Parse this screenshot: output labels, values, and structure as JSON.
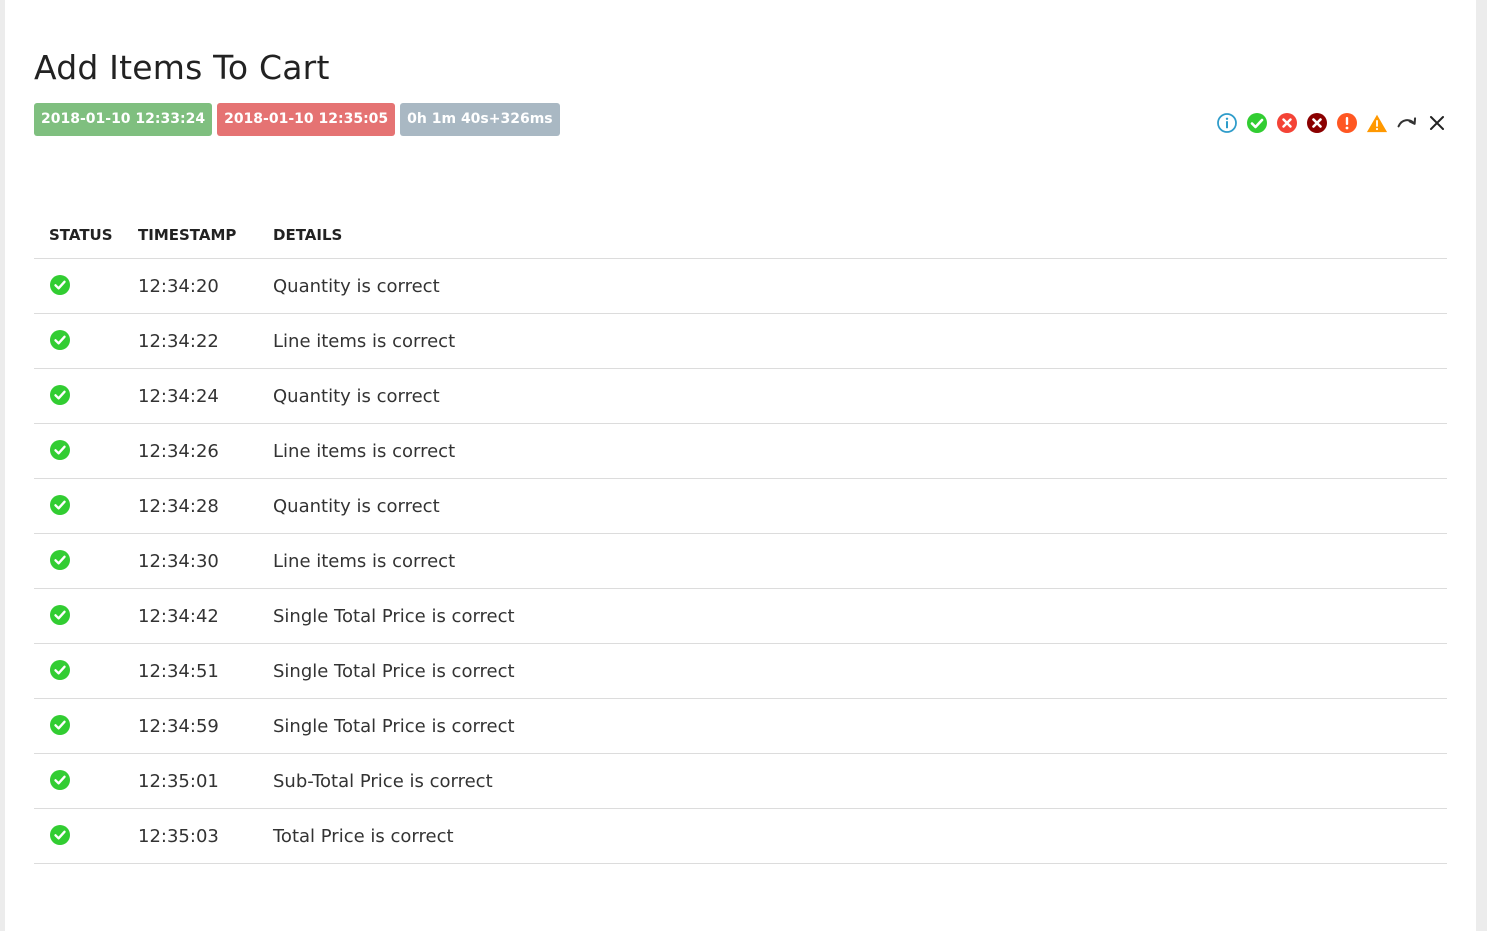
{
  "test": {
    "title": "Add Items To Cart",
    "start_time": "2018-01-10 12:33:24",
    "end_time": "2018-01-10 12:35:05",
    "duration": "0h 1m 40s+326ms"
  },
  "colors": {
    "pass": "#32cd32",
    "fail": "#f44336",
    "fatal": "#8b0000",
    "error": "#ff5722",
    "warning": "#ff9800",
    "info": "#2e9cca"
  },
  "filters": [
    {
      "name": "filter-info-icon",
      "icon": "info-circle-icon"
    },
    {
      "name": "filter-pass-icon",
      "icon": "check-circle-icon"
    },
    {
      "name": "filter-fail-icon",
      "icon": "x-circle-icon"
    },
    {
      "name": "filter-fatal-icon",
      "icon": "x-circle-dark-icon"
    },
    {
      "name": "filter-error-icon",
      "icon": "exclamation-circle-icon"
    },
    {
      "name": "filter-warning-icon",
      "icon": "warning-triangle-icon"
    },
    {
      "name": "filter-skip-icon",
      "icon": "redo-arrow-icon"
    },
    {
      "name": "clear-filter-icon",
      "icon": "close-icon"
    }
  ],
  "table": {
    "headers": {
      "status": "STATUS",
      "timestamp": "TIMESTAMP",
      "details": "DETAILS"
    },
    "rows": [
      {
        "status": "pass",
        "timestamp": "12:34:20",
        "details": "Quantity is correct"
      },
      {
        "status": "pass",
        "timestamp": "12:34:22",
        "details": "Line items is correct"
      },
      {
        "status": "pass",
        "timestamp": "12:34:24",
        "details": "Quantity is correct"
      },
      {
        "status": "pass",
        "timestamp": "12:34:26",
        "details": "Line items is correct"
      },
      {
        "status": "pass",
        "timestamp": "12:34:28",
        "details": "Quantity is correct"
      },
      {
        "status": "pass",
        "timestamp": "12:34:30",
        "details": "Line items is correct"
      },
      {
        "status": "pass",
        "timestamp": "12:34:42",
        "details": "Single Total Price is correct"
      },
      {
        "status": "pass",
        "timestamp": "12:34:51",
        "details": "Single Total Price is correct"
      },
      {
        "status": "pass",
        "timestamp": "12:34:59",
        "details": "Single Total Price is correct"
      },
      {
        "status": "pass",
        "timestamp": "12:35:01",
        "details": "Sub-Total Price is correct"
      },
      {
        "status": "pass",
        "timestamp": "12:35:03",
        "details": "Total Price is correct"
      }
    ]
  }
}
